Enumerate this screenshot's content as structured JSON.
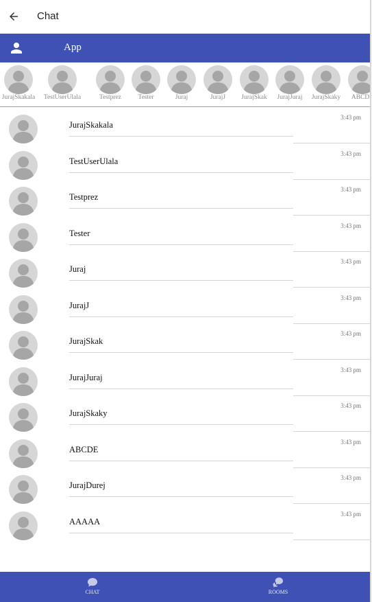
{
  "topbar": {
    "title": "Chat"
  },
  "appbar": {
    "title": "App"
  },
  "strip": [
    "JurajSkakala",
    "TestUserUlala",
    "Testprez",
    "Tester",
    "Juraj",
    "JurajJ",
    "JurajSkak",
    "JurajJuraj",
    "JurajSkaky",
    "ABCDE"
  ],
  "chats": [
    {
      "name": "JurajSkakala",
      "time": "3:43 pm"
    },
    {
      "name": "TestUserUlala",
      "time": "3:43 pm"
    },
    {
      "name": "Testprez",
      "time": "3:43 pm"
    },
    {
      "name": "Tester",
      "time": "3:43 pm"
    },
    {
      "name": "Juraj",
      "time": "3:43 pm"
    },
    {
      "name": "JurajJ",
      "time": "3:43 pm"
    },
    {
      "name": "JurajSkak",
      "time": "3:43 pm"
    },
    {
      "name": "JurajJuraj",
      "time": "3:43 pm"
    },
    {
      "name": "JurajSkaky",
      "time": "3:43 pm"
    },
    {
      "name": "ABCDE",
      "time": "3:43 pm"
    },
    {
      "name": "JurajDurej",
      "time": "3:43 pm"
    },
    {
      "name": "AAAAA",
      "time": "3:43 pm"
    }
  ],
  "nav": {
    "chat_label": "CHAT",
    "rooms_label": "ROOMS"
  },
  "colors": {
    "primary": "#3f51b5",
    "avatar_bg": "#d6d6d6",
    "avatar_fg": "#a6a6a6"
  },
  "icons": [
    "back-arrow-icon",
    "user-icon",
    "avatar-placeholder-icon",
    "chat-bubble-icon",
    "rooms-bubbles-icon"
  ]
}
